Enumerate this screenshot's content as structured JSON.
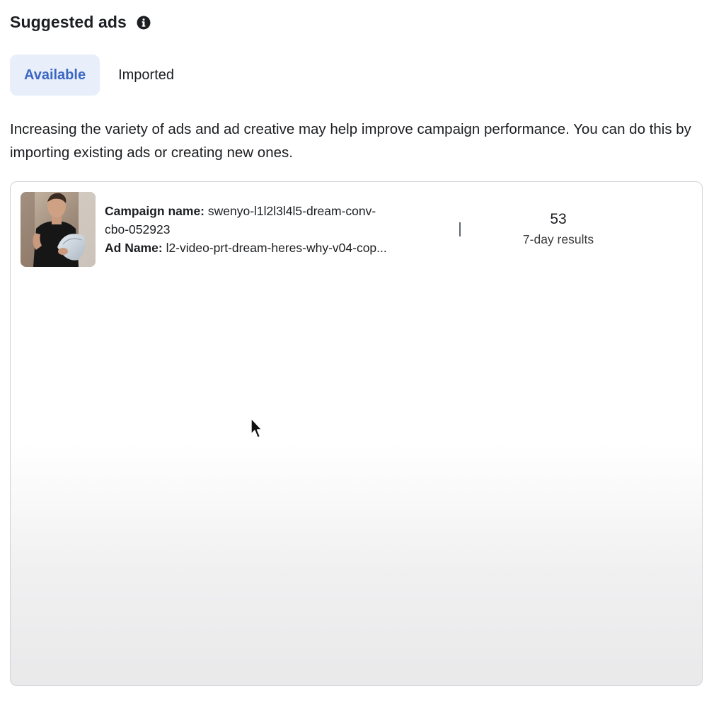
{
  "section": {
    "title": "Suggested ads",
    "info_icon": "info-icon"
  },
  "tabs": [
    {
      "label": "Available",
      "active": true
    },
    {
      "label": "Imported",
      "active": false
    }
  ],
  "description": "Increasing the variety of ads and ad creative may help improve campaign performance. You can do this by importing existing ads or creating new ones.",
  "ads": [
    {
      "campaign_label": "Campaign name:",
      "campaign_value_line1": "swenyo-l1l2l3l4l5-dream-conv-",
      "campaign_value_line2": "cbo-052923",
      "ad_label": "Ad Name:",
      "ad_value": "l2-video-prt-dream-heres-why-v04-cop...",
      "metric_value": "53",
      "metric_label": "7-day results"
    }
  ],
  "colors": {
    "accent": "#3b67c4",
    "active_tab_bg": "#e8eefa",
    "card_border": "#cfd3d8"
  }
}
